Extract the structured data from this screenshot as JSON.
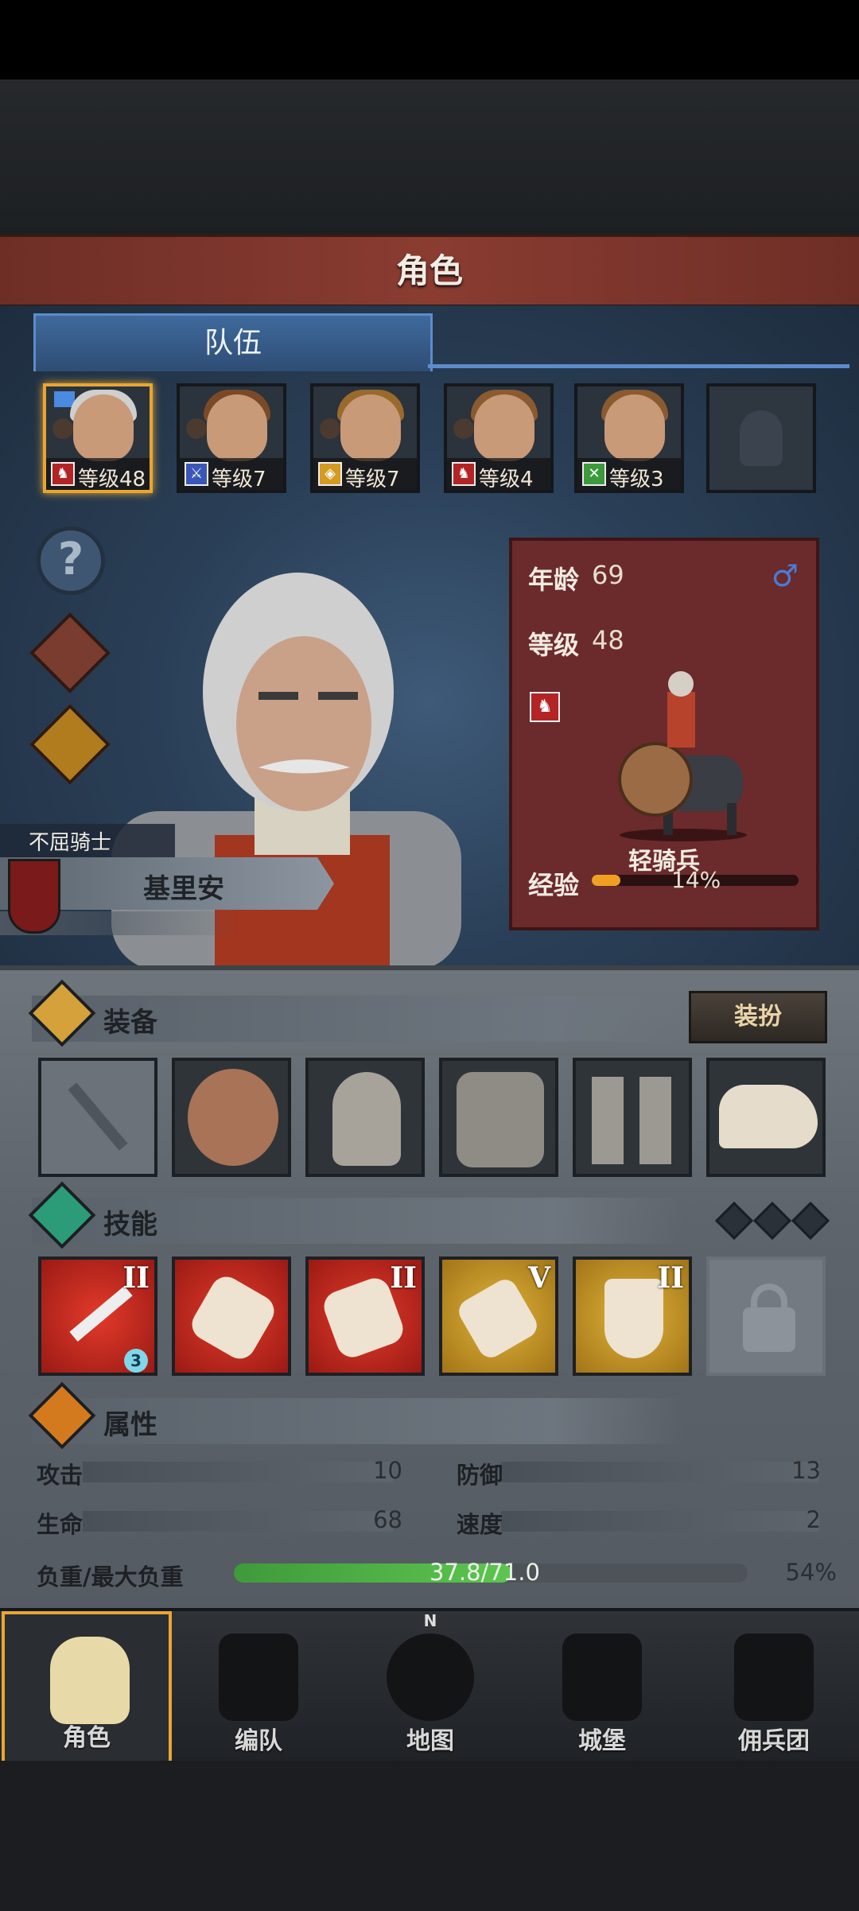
{
  "title": "角色",
  "tab": "队伍",
  "party": [
    {
      "level_label": "等级48",
      "class_icon": "horse-icon",
      "selected": true
    },
    {
      "level_label": "等级7",
      "class_icon": "sword-icon"
    },
    {
      "level_label": "等级7",
      "class_icon": "shield-icon"
    },
    {
      "level_label": "等级4",
      "class_icon": "horse-icon"
    },
    {
      "level_label": "等级3",
      "class_icon": "crossed-swords-icon"
    }
  ],
  "hero": {
    "title": "不屈骑士",
    "name": "基里安",
    "age_label": "年龄",
    "age": "69",
    "level_label": "等级",
    "level": "48",
    "unit_type": "轻骑兵",
    "xp_label": "经验",
    "xp_percent": "14%",
    "xp_fraction": 0.14,
    "gender_icon": "male-icon"
  },
  "equipment": {
    "header": "装备",
    "dress_button": "装扮",
    "items": [
      "dagger-icon",
      "round-shield-icon",
      "helmet-icon",
      "chainmail-icon",
      "boots-icon",
      "horn-icon"
    ]
  },
  "skills": {
    "header": "技能",
    "items": [
      {
        "rank": "II",
        "badge": "3"
      },
      {
        "rank": ""
      },
      {
        "rank": "II"
      },
      {
        "rank": "V"
      },
      {
        "rank": "II"
      }
    ]
  },
  "attributes": {
    "header": "属性",
    "attack_label": "攻击",
    "attack": "10",
    "defense_label": "防御",
    "defense": "13",
    "hp_label": "生命",
    "hp": "68",
    "speed_label": "速度",
    "speed": "2",
    "load_label": "负重/最大负重",
    "load": "37.8/71.0",
    "load_percent": "54%",
    "load_fraction": 0.54
  },
  "nav": [
    {
      "label": "角色",
      "icon": "knight-icon"
    },
    {
      "label": "编队",
      "icon": "helmet-group-icon"
    },
    {
      "label": "地图",
      "icon": "compass-icon",
      "extra": "N"
    },
    {
      "label": "城堡",
      "icon": "castle-icon"
    },
    {
      "label": "佣兵团",
      "icon": "banner-icon"
    }
  ]
}
